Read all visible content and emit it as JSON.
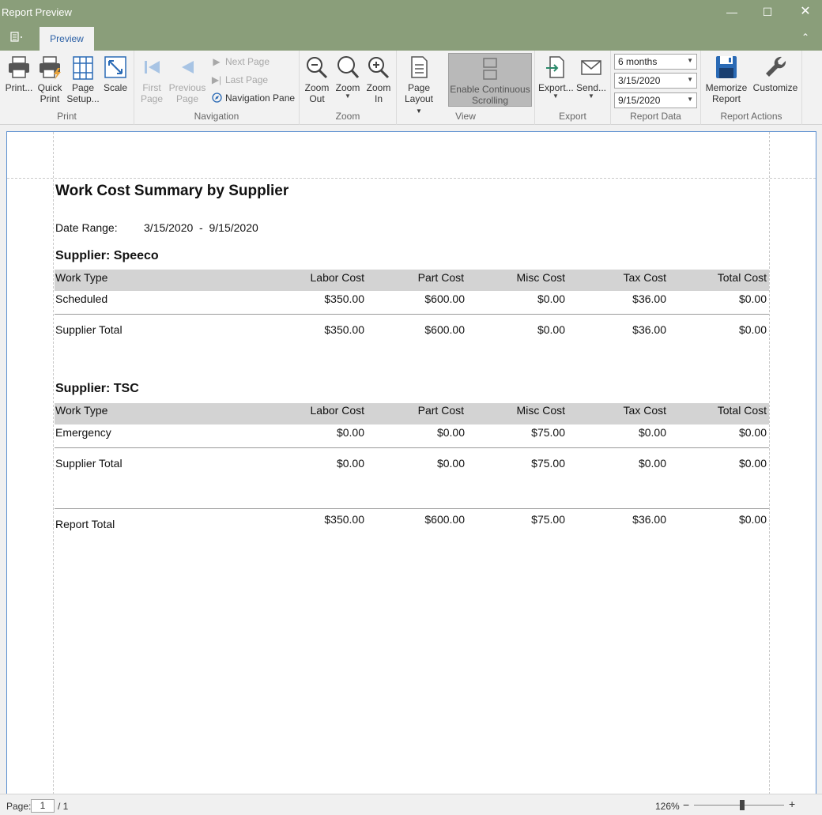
{
  "window": {
    "title": "Report Preview"
  },
  "tabs": {
    "preview": "Preview"
  },
  "ribbon": {
    "print": {
      "print": "Print...",
      "quick_print_1": "Quick",
      "quick_print_2": "Print",
      "page_setup_1": "Page",
      "page_setup_2": "Setup...",
      "scale": "Scale",
      "caption": "Print"
    },
    "navigation": {
      "first_page_1": "First",
      "first_page_2": "Page",
      "previous_page_1": "Previous",
      "previous_page_2": "Page",
      "next_page": "Next Page",
      "last_page": "Last Page",
      "navigation_pane": "Navigation Pane",
      "caption": "Navigation"
    },
    "zoom": {
      "zoom_out_1": "Zoom",
      "zoom_out_2": "Out",
      "zoom": "Zoom",
      "zoom_in_1": "Zoom",
      "zoom_in_2": "In",
      "caption": "Zoom"
    },
    "view": {
      "page_layout_1": "Page",
      "page_layout_2": "Layout",
      "continuous_1": "Enable Continuous",
      "continuous_2": "Scrolling",
      "caption": "View"
    },
    "export": {
      "export": "Export...",
      "send": "Send...",
      "caption": "Export"
    },
    "report_data": {
      "period": "6 months",
      "start_date": "3/15/2020",
      "end_date": "9/15/2020",
      "caption": "Report Data"
    },
    "report_actions": {
      "memorize_1": "Memorize",
      "memorize_2": "Report",
      "customize": "Customize",
      "caption": "Report Actions"
    }
  },
  "report": {
    "title": "Work Cost Summary by Supplier",
    "date_range_label": "Date Range:",
    "date_range_value": "3/15/2020  -  9/15/2020",
    "columns": [
      "Work Type",
      "Labor Cost",
      "Part Cost",
      "Misc Cost",
      "Tax Cost",
      "Total Cost"
    ],
    "suppliers": [
      {
        "heading": "Supplier: Speeco",
        "rows": [
          [
            "Scheduled",
            "$350.00",
            "$600.00",
            "$0.00",
            "$36.00",
            "$0.00"
          ]
        ],
        "total": [
          "Supplier Total",
          "$350.00",
          "$600.00",
          "$0.00",
          "$36.00",
          "$0.00"
        ]
      },
      {
        "heading": "Supplier: TSC",
        "rows": [
          [
            "Emergency",
            "$0.00",
            "$0.00",
            "$75.00",
            "$0.00",
            "$0.00"
          ]
        ],
        "total": [
          "Supplier Total",
          "$0.00",
          "$0.00",
          "$75.00",
          "$0.00",
          "$0.00"
        ]
      }
    ],
    "report_total": [
      "Report Total",
      "$350.00",
      "$600.00",
      "$75.00",
      "$36.00",
      "$0.00"
    ]
  },
  "status": {
    "page_label": "Page:",
    "page_value": "1",
    "page_of": "/ 1",
    "zoom": "126%",
    "zoom_minus": "−",
    "zoom_plus": "+"
  }
}
